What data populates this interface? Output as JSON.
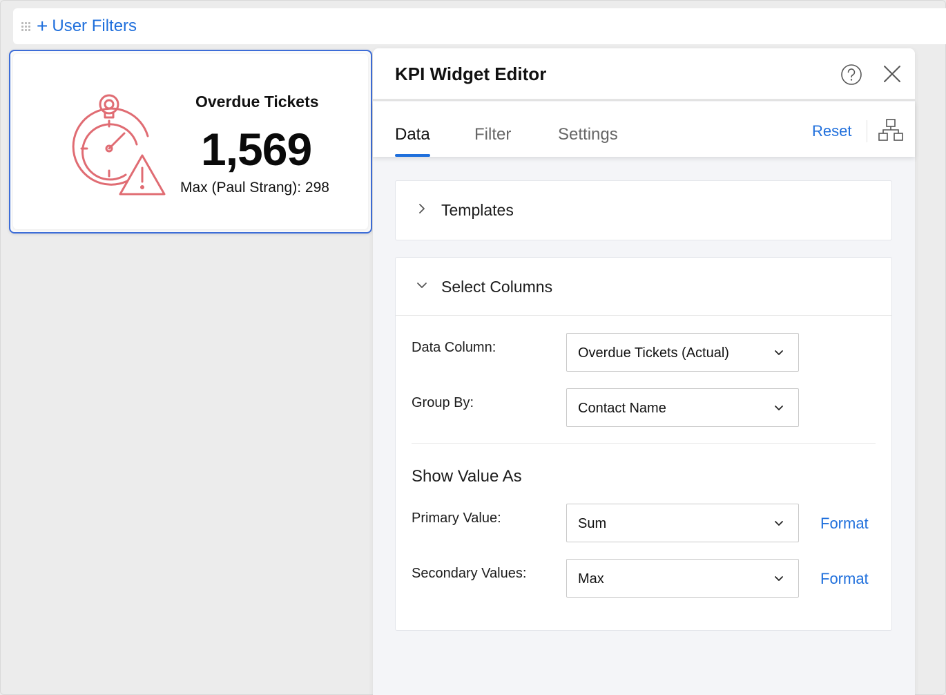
{
  "filter_bar": {
    "label": "User Filters"
  },
  "kpi": {
    "title": "Overdue Tickets",
    "value": "1,569",
    "secondary": "Max (Paul Strang): 298"
  },
  "editor": {
    "title": "KPI Widget Editor",
    "tabs": [
      {
        "label": "Data",
        "active": true
      },
      {
        "label": "Filter",
        "active": false
      },
      {
        "label": "Settings",
        "active": false
      }
    ],
    "reset_label": "Reset",
    "templates": {
      "title": "Templates"
    },
    "select_columns": {
      "title": "Select Columns",
      "data_column": {
        "label": "Data Column:",
        "value": "Overdue Tickets (Actual)"
      },
      "group_by": {
        "label": "Group By:",
        "value": "Contact Name"
      },
      "show_value_as": "Show Value As",
      "primary_value": {
        "label": "Primary Value:",
        "value": "Sum",
        "format_label": "Format"
      },
      "secondary_values": {
        "label": "Secondary Values:",
        "value": "Max",
        "format_label": "Format"
      }
    }
  },
  "colors": {
    "accent": "#1f6fdc",
    "kpi_icon": "#e06c73",
    "selection_border": "#3d6dd8"
  }
}
